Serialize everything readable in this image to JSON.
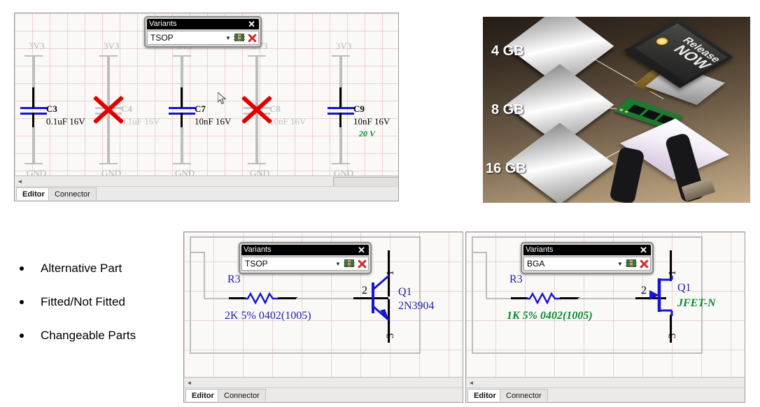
{
  "top_left_panel": {
    "variants_dialog": {
      "title": "Variants",
      "close_label": "✕",
      "selected": "TSOP",
      "caret": "▼",
      "icons": [
        "chip-icon",
        "red-x-icon"
      ]
    },
    "nets": [
      "3V3",
      "3V3",
      "3V3",
      "3V3",
      "3V3"
    ],
    "grounds": [
      "GND",
      "GND",
      "GND",
      "GND",
      "GND"
    ],
    "components": [
      {
        "ref": "C3",
        "value": "0.1uF 16V",
        "state": "fitted",
        "variant_value": ""
      },
      {
        "ref": "C4",
        "value": "0.1uF 16V",
        "state": "not-fitted",
        "variant_value": ""
      },
      {
        "ref": "C7",
        "value": "10nF 16V",
        "state": "fitted",
        "variant_value": ""
      },
      {
        "ref": "C8",
        "value": "10nF 16V",
        "state": "not-fitted",
        "variant_value": ""
      },
      {
        "ref": "C9",
        "value": "10nF 16V",
        "state": "fitted",
        "variant_value": "20 V"
      }
    ],
    "tabs": [
      {
        "label": "Editor",
        "active": true
      },
      {
        "label": "Connector",
        "active": false
      }
    ],
    "scroll_left_arrow": "◄"
  },
  "photo": {
    "capacity_labels": [
      "4 GB",
      "8 GB",
      "16 GB"
    ],
    "screen_text_line1": "Release",
    "screen_text_line2": "NOW"
  },
  "bullets": {
    "items": [
      "Alternative Part",
      "Fitted/Not Fitted",
      "Changeable Parts"
    ]
  },
  "bottom_left_panel": {
    "variants_dialog": {
      "title": "Variants",
      "close_label": "✕",
      "selected": "TSOP",
      "caret": "▼",
      "icons": [
        "chip-icon",
        "red-x-icon"
      ]
    },
    "resistor": {
      "ref": "R3",
      "value": "2K 5% 0402(1005)",
      "value_style": "default"
    },
    "transistor": {
      "ref": "Q1",
      "value": "2N3904",
      "value_style": "default",
      "type": "npn-bjt"
    },
    "pins": [
      "1",
      "2",
      "3"
    ],
    "tabs": [
      {
        "label": "Editor",
        "active": true
      },
      {
        "label": "Connector",
        "active": false
      }
    ],
    "scroll_left_arrow": "◄"
  },
  "bottom_right_panel": {
    "variants_dialog": {
      "title": "Variants",
      "close_label": "✕",
      "selected": "BGA",
      "caret": "▼",
      "icons": [
        "chip-icon",
        "red-x-icon"
      ]
    },
    "resistor": {
      "ref": "R3",
      "value": "1K 5% 0402(1005)",
      "value_style": "changed"
    },
    "transistor": {
      "ref": "Q1",
      "value": "JFET-N",
      "value_style": "changed",
      "type": "jfet-n"
    },
    "pins": [
      "1",
      "2",
      "3"
    ],
    "tabs": [
      {
        "label": "Editor",
        "active": true
      },
      {
        "label": "Connector",
        "active": false
      }
    ],
    "scroll_left_arrow": "◄"
  },
  "colors": {
    "wire_blue": "#1414d2",
    "changed_green": "#0a8a32",
    "not_fitted_red": "#e00000",
    "label_blue": "#1f1fa8",
    "dim_grey": "#c2c2c2"
  }
}
